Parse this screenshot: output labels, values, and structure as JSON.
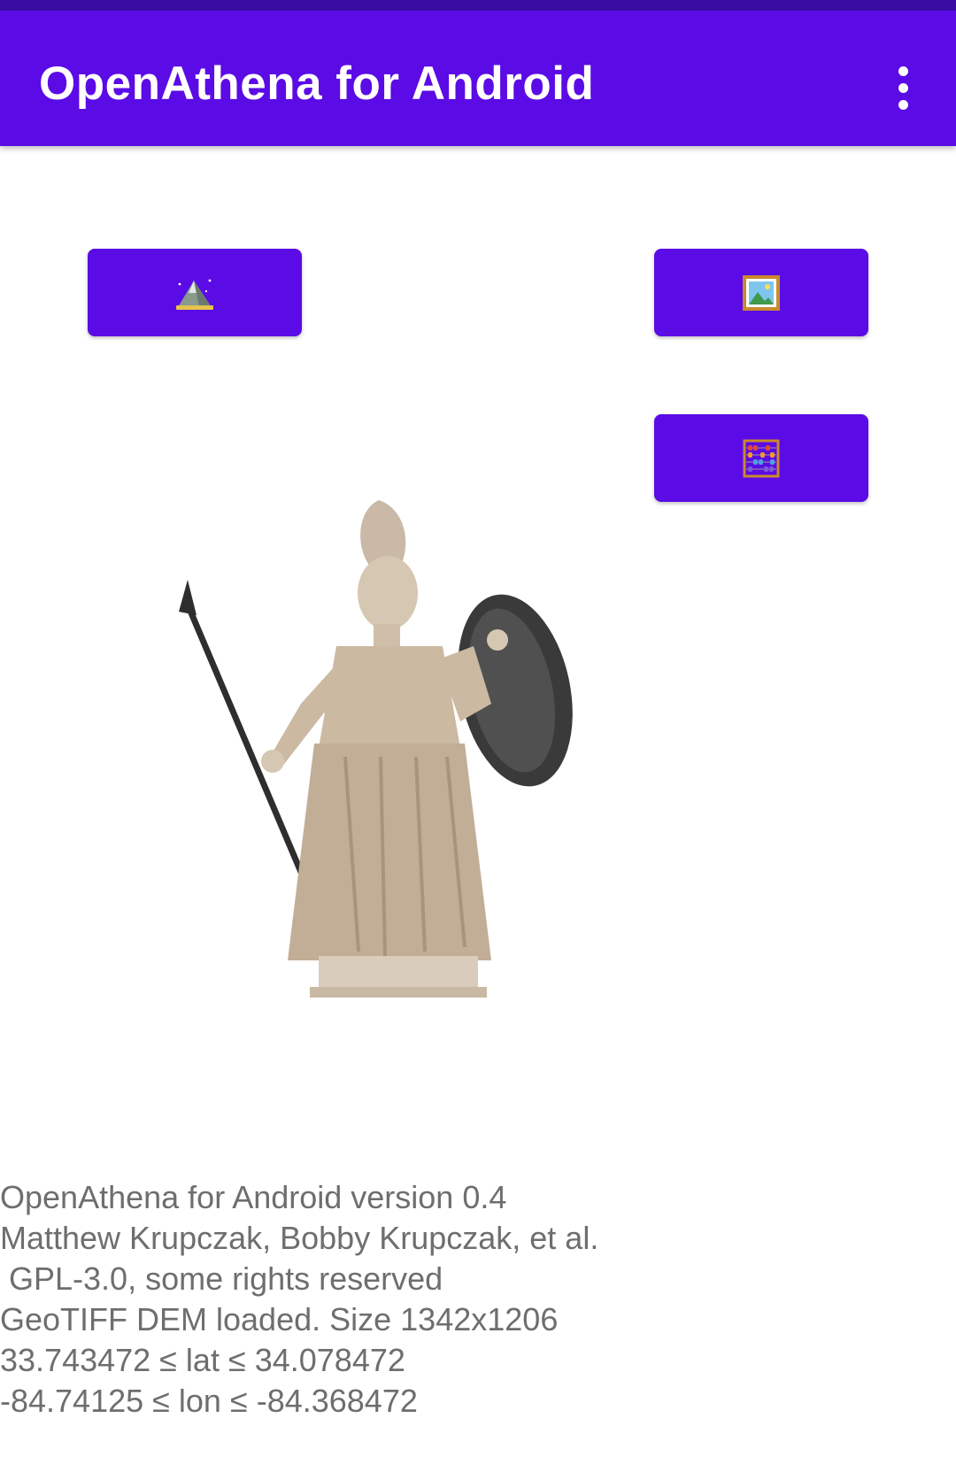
{
  "app_bar": {
    "title": "OpenAthena for Android",
    "menu_icon": "more-vert-icon"
  },
  "buttons": {
    "dem": {
      "icon": "mountain-icon"
    },
    "image": {
      "icon": "framed-picture-icon"
    },
    "calculate": {
      "icon": "abacus-icon"
    }
  },
  "colors": {
    "primary": "#5b0be5",
    "status_bar": "#3a0ca3",
    "info_text": "#6e6e6e"
  },
  "info": {
    "lines": [
      "OpenAthena for Android version 0.4",
      "Matthew Krupczak, Bobby Krupczak, et al.",
      " GPL-3.0, some rights reserved",
      "GeoTIFF DEM loaded. Size 1342x1206",
      "33.743472 ≤ lat ≤ 34.078472",
      "-84.74125 ≤ lon ≤ -84.368472"
    ]
  }
}
